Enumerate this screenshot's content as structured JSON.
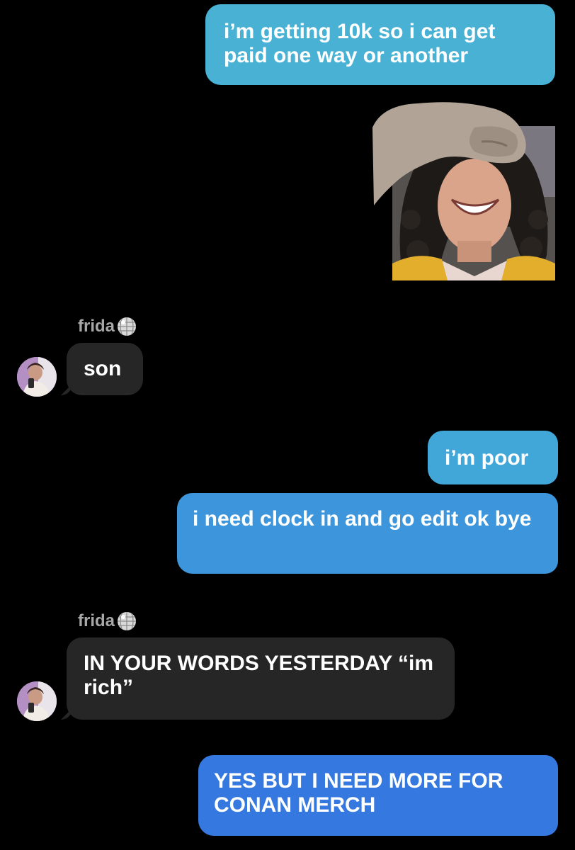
{
  "messages": {
    "m1": "i’m getting 10k so i can get paid one way or another",
    "m2_sender": "frida",
    "m2": "son",
    "m3": "i’m poor",
    "m4": "i need clock in and go edit ok bye",
    "m5_sender": "frida",
    "m5": "IN YOUR WORDS YESTERDAY “im rich”",
    "m6": "YES BUT I NEED MORE FOR CONAN MERCH"
  },
  "colors": {
    "outgoing_top": "#4cb3d6",
    "outgoing_mid": "#3d8ee0",
    "outgoing_bottom": "#3478e0",
    "incoming": "#262626",
    "sender_name": "#a8a8a8"
  },
  "icons": {
    "sender_badge": "disco-ball-icon",
    "sticker": "hand-over-face-sticker"
  }
}
